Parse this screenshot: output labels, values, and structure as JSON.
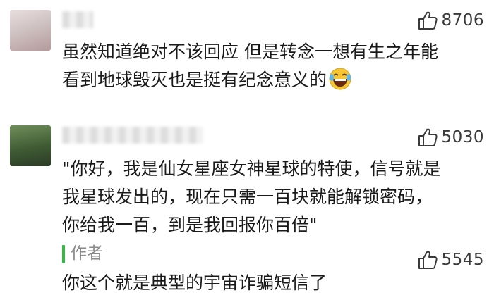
{
  "comments": [
    {
      "likes": "8706",
      "text": "虽然知道绝对不该回应 但是转念一想有生之年能\n看到地球毁灭也是挺有纪念意义的",
      "emoji": "laughing-tears-emoji"
    },
    {
      "likes": "5030",
      "text": "\"你好，我是仙女星座女神星球的特使，信号就是\n我星球发出的，现在只需一百块就能解锁密码，\n你给我一百，到是我回报你百倍\"",
      "reply": {
        "author": "作者",
        "likes": "5545",
        "text": "你这个就是典型的宇宙诈骗短信了"
      }
    }
  ],
  "icons": {
    "like": "thumbs-up-icon"
  },
  "colors": {
    "author_bar": "#39b54a"
  }
}
